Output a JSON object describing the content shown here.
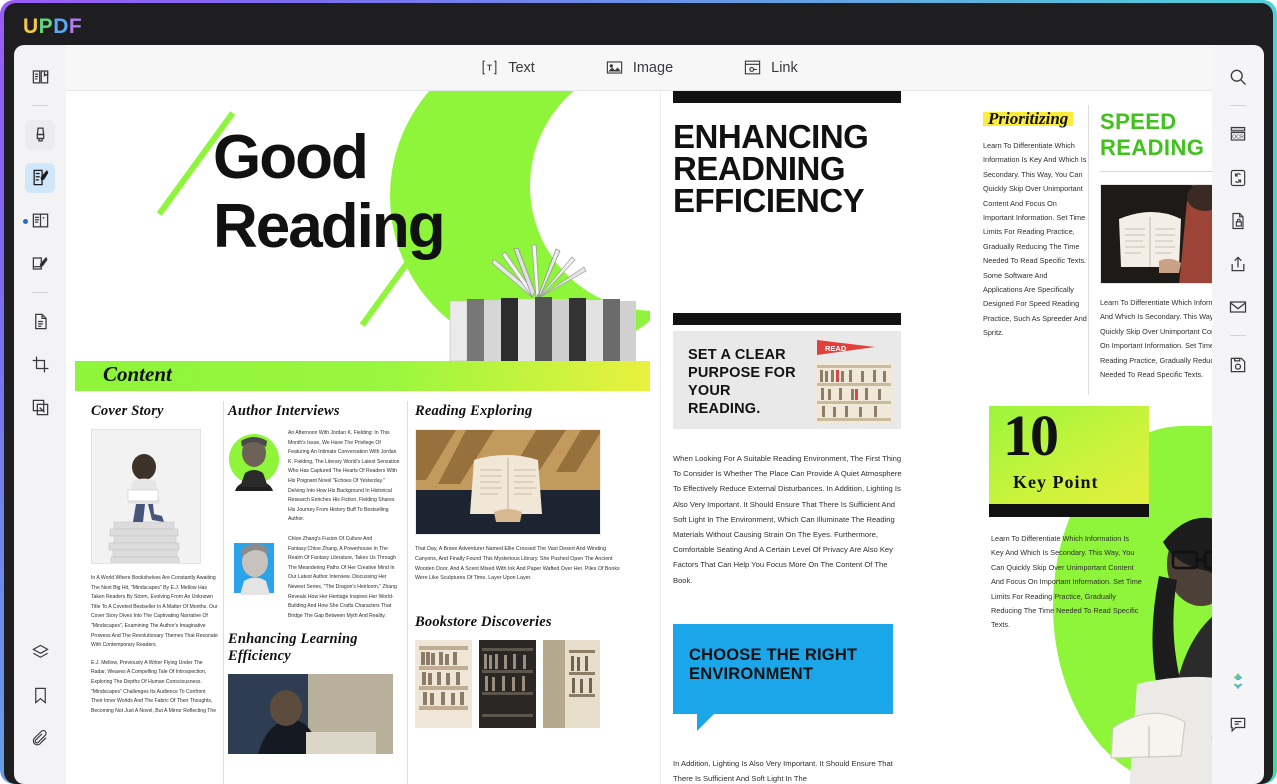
{
  "app": {
    "name": "UPDF",
    "logo_letters": [
      "U",
      "P",
      "D",
      "F"
    ],
    "accent_colors": {
      "u": "#f5c842",
      "p": "#5fd47a",
      "d": "#5aa9f5",
      "f": "#b07cf0",
      "highlight_blue": "#cfe6fb"
    }
  },
  "toolbar": {
    "items": [
      {
        "label": "Text",
        "icon": "text-box-icon"
      },
      {
        "label": "Image",
        "icon": "image-icon"
      },
      {
        "label": "Link",
        "icon": "link-card-icon"
      }
    ]
  },
  "left_rail": {
    "items": [
      {
        "name": "reader-mode",
        "icon": "open-book-icon",
        "state": "normal"
      },
      {
        "name": "highlight-tool",
        "icon": "highlighter-icon",
        "state": "hover"
      },
      {
        "name": "edit-pdf-tool",
        "icon": "edit-document-icon",
        "state": "active"
      },
      {
        "name": "annotate-tool",
        "icon": "annotate-book-icon",
        "state": "normal"
      },
      {
        "name": "sign-tool",
        "icon": "signature-icon",
        "state": "normal"
      },
      {
        "name": "page-tool",
        "icon": "page-icon",
        "state": "normal"
      },
      {
        "name": "crop-tool",
        "icon": "crop-icon",
        "state": "normal"
      },
      {
        "name": "batch-tool",
        "icon": "stacked-pages-icon",
        "state": "normal"
      }
    ],
    "bottom_items": [
      {
        "name": "layers",
        "icon": "layers-icon"
      },
      {
        "name": "bookmarks",
        "icon": "bookmark-icon"
      },
      {
        "name": "attachments",
        "icon": "paperclip-icon"
      }
    ]
  },
  "right_rail": {
    "items": [
      {
        "name": "search",
        "icon": "search-icon"
      },
      {
        "name": "ocr",
        "icon": "ocr-icon"
      },
      {
        "name": "convert",
        "icon": "convert-file-icon"
      },
      {
        "name": "protect",
        "icon": "lock-file-icon"
      },
      {
        "name": "share",
        "icon": "share-upload-icon"
      },
      {
        "name": "email",
        "icon": "envelope-icon"
      },
      {
        "name": "save",
        "icon": "save-disk-icon"
      }
    ],
    "bottom_items": [
      {
        "name": "ai-assistant",
        "icon": "ai-sparkle-icon"
      },
      {
        "name": "comments",
        "icon": "comment-bubble-icon"
      }
    ]
  },
  "document": {
    "page_left": {
      "hero": {
        "title_line1": "Good",
        "title_line2": "Reading",
        "band_label": "Content"
      },
      "columns": [
        {
          "title": "Cover Story",
          "paragraphs": [
            "In A World Where Bookshelves Are Constantly Awaiting The Next Big Hit, \"Mindscapes\" By E.J. Mellow Has Taken Readers By Storm, Evolving From An Unknown Title To A Coveted Bestseller In A Matter Of Months. Our Cover Story Dives Into The Captivating Narrative Of \"Mindscapes\", Examining The Author's Imaginative Prowess And The Revolutionary Themes That Resonate With Contemporary Readers.",
            "E.J. Mellow, Previously A Writer Flying Under The Radar, Weaves A Compelling Tale Of Introspection, Exploring The Depths Of Human Consciousness. \"Mindscapes\" Challenges Its Audience To Confront Their Inner Worlds And The Fabric Of Their Thoughts, Becoming Not Just A Novel, But A Mirror Reflecting The"
          ]
        },
        {
          "title": "Author Interviews",
          "paragraphs": [
            "An Afternoon With Jordan K. Fielding: In This Month's Issue, We Have The Privilege Of Featuring An Intimate Conversation With Jordan K. Fielding, The Literary World's Latest Sensation Who Has Captured The Hearts Of Readers With His Poignant Novel \"Echoes Of Yesterday.\" Delving Into How His Background In Historical Research Enriches His Fiction, Fielding Shares His Journey From History Buff To Bestselling Author.",
            "Chloe Zhang's Fusion Of Culture And Fantasy:Chloe Zhang, A Powerhouse In The Realm Of Fantasy Literature, Takes Us Through The Meandering Paths Of Her Creative Mind In Our Latest Author Interview. Discussing Her Newest Series, \"The Dragon's Heirloom,\" Zhang Reveals How Her Heritage Inspires Her World-Building And How She Crafts Characters That Bridge The Gap Between Myth And Reality."
          ],
          "subtitle": "Enhancing Learning Efficiency"
        },
        {
          "title": "Reading Exploring",
          "paragraphs": [
            "That Day, A Brave Adventurer Named Ellie Crossed The Vast Desert And Winding Canyons, And Finally Found This Mysterious Library. She Pushed Open The Ancient Wooden Door, And A Scent Mixed With Ink And Paper Wafted Over Her. Piles Of Books Were Like Sculptures Of Time, Layer Upon Layer."
          ],
          "subtitle": "Bookstore Discoveries"
        }
      ]
    },
    "page_mid": {
      "headline": [
        "ENHANCING",
        "READNING",
        "EFFICIENCY"
      ],
      "quote_box": {
        "text": "SET A CLEAR PURPOSE FOR YOUR READING.",
        "flag_label": "READ"
      },
      "body": "When Looking For A Suitable Reading Environment, The First Thing To Consider Is Whether The Place Can Provide A Quiet Atmosphere To Effectively Reduce External Disturbances. In Addition, Lighting Is Also Very Important. It Should Ensure That There Is Sufficient And Soft Light In The Environment, Which Can Illuminate The Reading Materials Without Causing Strain On The Eyes. Furthermore, Comfortable Seating And A Certain Level Of Privacy Are Also Key Factors That Can Help You Focus More On The Content Of The Book.",
      "callout": "CHOOSE THE RIGHT ENVIRONMENT",
      "body_after": "In Addition, Lighting Is Also Very Important. It Should Ensure That There Is Sufficient And Soft Light In The"
    },
    "page_right": {
      "prioritizing": {
        "title": "Prioritizing",
        "body": "Learn To Differentiate Which Information Is Key And Which Is Secondary. This Way, You Can Quickly Skip Over Unimportant Content And Focus On Important Information. Set Time Limits For Reading Practice, Gradually Reducing The Time Needed To Read Specific Texts. Some Software And Applications Are Specifically Designed For Speed Reading Practice, Such As Spreeder And Spritz."
      },
      "speed_reading": {
        "title": "SPEED READING",
        "body": "Learn To Differentiate Which Information Is Key And Which Is Secondary. This Way, You Can Quickly Skip Over Unimportant Content And Focus On Important Information. Set Time Limits For Reading Practice, Gradually Reducing The Time Needed To Read Specific Texts."
      },
      "key_point": {
        "number": "10",
        "label": "Key Point",
        "body": "Learn To Differentiate Which Information Is Key And Which Is Secondary. This Way, You Can Quickly Skip Over Unimportant Content And Focus On Important Information. Set Time Limits For Reading Practice, Gradually Reducing The Time Needed To Read Specific Texts."
      }
    }
  }
}
